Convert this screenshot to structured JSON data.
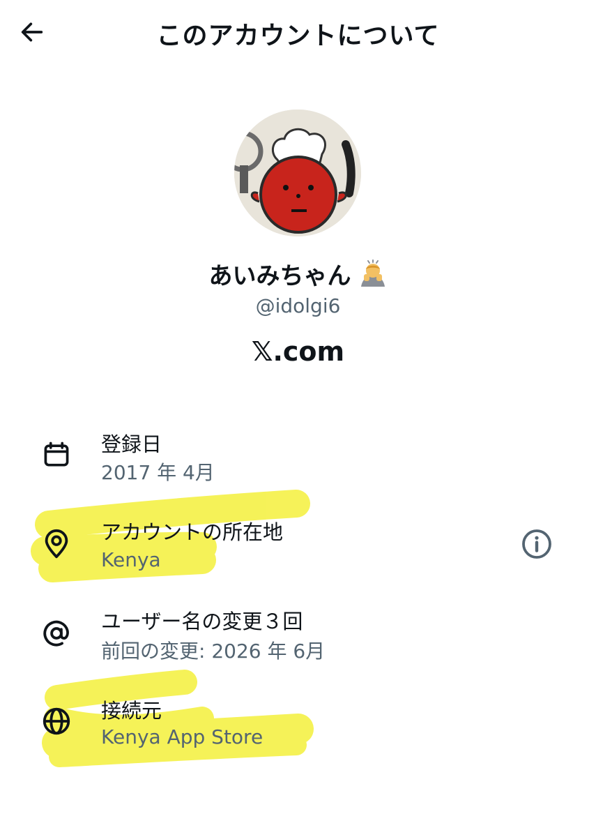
{
  "header": {
    "title": "このアカウントについて",
    "back_icon": "arrow-left-icon"
  },
  "profile": {
    "display_name": "あいみちゃん",
    "emoji": "person-bowing-emoji",
    "handle": "@idolgi6",
    "domain": "𝕏.com"
  },
  "details": [
    {
      "icon": "calendar-icon",
      "label": "登録日",
      "value": "2017 年 4月"
    },
    {
      "icon": "location-pin-icon",
      "label": "アカウントの所在地",
      "value": "Kenya"
    },
    {
      "icon": "at-sign-icon",
      "label": "ユーザー名の変更３回",
      "value": "前回の変更: 2026 年 6月"
    },
    {
      "icon": "globe-icon",
      "label": "接続元",
      "value": "Kenya App Store"
    }
  ],
  "colors": {
    "text": "#0f1419",
    "secondary": "#536471",
    "highlighter": "#f6f23a",
    "avatar_face": "#c8241c"
  }
}
